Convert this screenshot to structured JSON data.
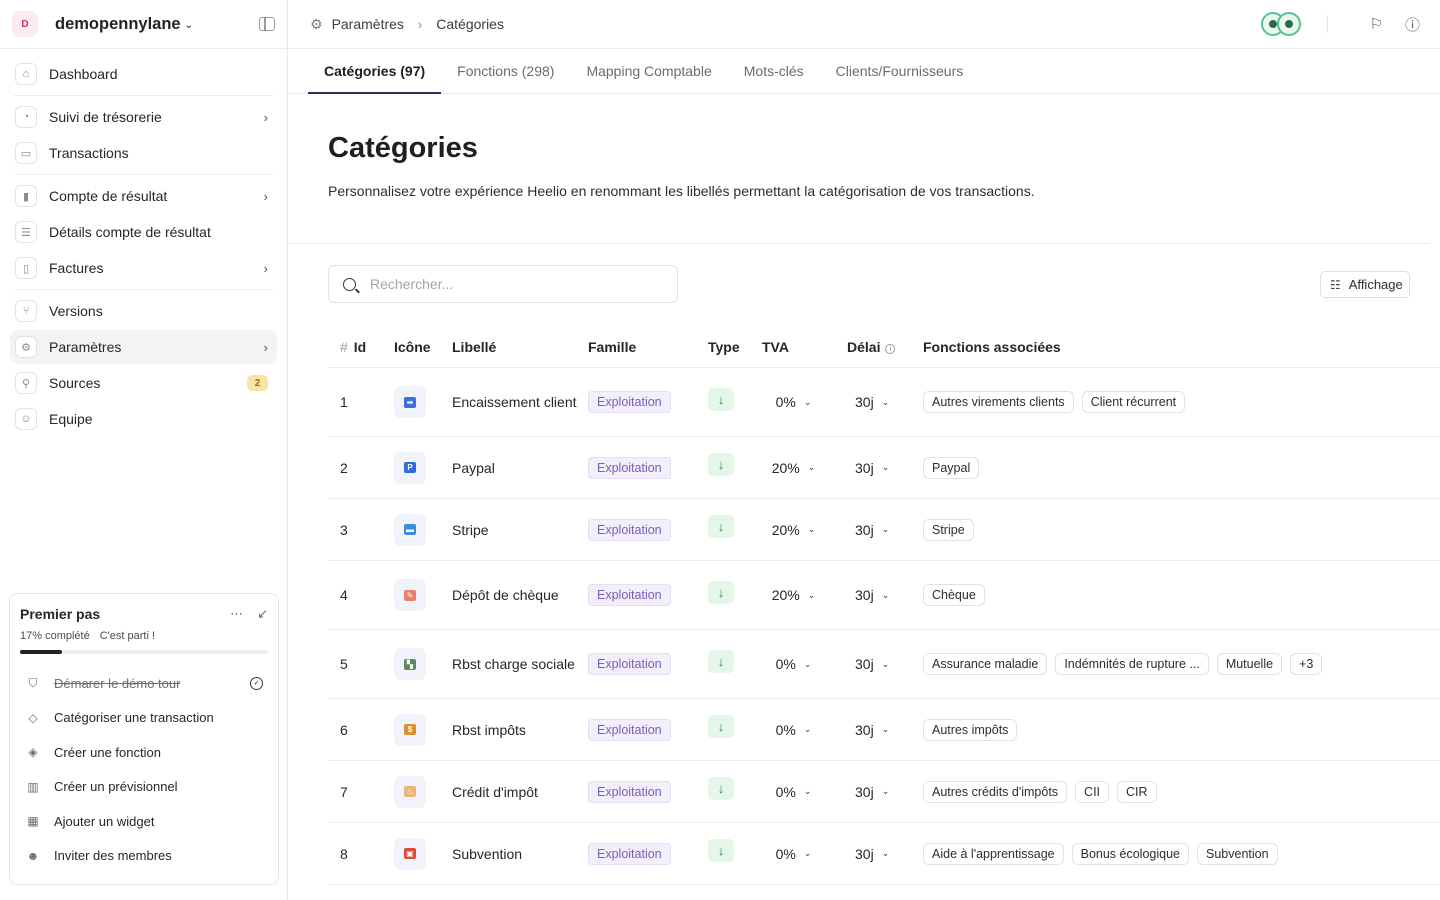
{
  "workspace": {
    "avatar": "D",
    "name": "demopennylane"
  },
  "nav": [
    {
      "label": "Dashboard",
      "icon": "home-icon",
      "glyph": "⌂",
      "chevron": false
    },
    {
      "sep": true
    },
    {
      "label": "Suivi de trésorerie",
      "icon": "chart-icon",
      "glyph": "◔",
      "chevron": true
    },
    {
      "label": "Transactions",
      "icon": "card-icon",
      "glyph": "▭",
      "chevron": false
    },
    {
      "sep": true
    },
    {
      "label": "Compte de résultat",
      "icon": "bar-chart-icon",
      "glyph": "▮",
      "chevron": true
    },
    {
      "label": "Détails compte de résultat",
      "icon": "list-icon",
      "glyph": "☰",
      "chevron": false
    },
    {
      "label": "Factures",
      "icon": "file-icon",
      "glyph": "▯",
      "chevron": true
    },
    {
      "sep": true
    },
    {
      "label": "Versions",
      "icon": "branch-icon",
      "glyph": "⑂",
      "chevron": false
    },
    {
      "label": "Paramètres",
      "icon": "gear-icon",
      "glyph": "⚙",
      "chevron": true,
      "active": true
    },
    {
      "label": "Sources",
      "icon": "plug-icon",
      "glyph": "⚲",
      "chevron": false,
      "badge": "2"
    },
    {
      "label": "Equipe",
      "icon": "user-icon",
      "glyph": "☺",
      "chevron": false
    }
  ],
  "onboarding": {
    "title": "Premier pas",
    "progress_text": "17% complété",
    "progress_value": 0.17,
    "status_text": "C'est parti !",
    "items": [
      {
        "label": "Démarer le démo tour",
        "icon": "shield-icon",
        "glyph": "⛉",
        "done": true
      },
      {
        "label": "Catégoriser une transaction",
        "icon": "tag-icon",
        "glyph": "◇"
      },
      {
        "label": "Créer une fonction",
        "icon": "tags-icon",
        "glyph": "◈"
      },
      {
        "label": "Créer un prévisionnel",
        "icon": "forecast-icon",
        "glyph": "▥"
      },
      {
        "label": "Ajouter un widget",
        "icon": "grid-icon",
        "glyph": "▦"
      },
      {
        "label": "Inviter des membres",
        "icon": "users-icon",
        "glyph": "☻"
      }
    ]
  },
  "breadcrumb": [
    "Paramètres",
    "Catégories"
  ],
  "tabs": [
    {
      "label": "Catégories (97)",
      "active": true
    },
    {
      "label": "Fonctions (298)"
    },
    {
      "label": "Mapping Comptable"
    },
    {
      "label": "Mots-clés"
    },
    {
      "label": "Clients/Fournisseurs"
    }
  ],
  "page": {
    "title": "Catégories",
    "description": "Personnalisez votre expérience Heelio en renommant les libellés permettant la catégorisation de vos transactions."
  },
  "search": {
    "placeholder": "Rechercher..."
  },
  "display_button": "Affichage",
  "table": {
    "headers": {
      "hash": "#",
      "id": "Id",
      "icon": "Icône",
      "label": "Libellé",
      "family": "Famille",
      "type": "Type",
      "tva": "TVA",
      "delay": "Délai",
      "functions": "Fonctions associées"
    },
    "rows": [
      {
        "id": "1",
        "label": "Encaissement client",
        "icon": "transfer-icon",
        "icon_color": "#3b6fd9",
        "icon_glyph": "➡",
        "family": "Exploitation",
        "tva": "0%",
        "delay": "30j",
        "functions": [
          "Autres virements clients",
          "Client récurrent"
        ]
      },
      {
        "id": "2",
        "label": "Paypal",
        "icon": "paypal-icon",
        "icon_color": "#2d6cdf",
        "icon_glyph": "P",
        "family": "Exploitation",
        "tva": "20%",
        "delay": "30j",
        "functions": [
          "Paypal"
        ]
      },
      {
        "id": "3",
        "label": "Stripe",
        "icon": "credit-card-icon",
        "icon_color": "#3b8fd9",
        "icon_glyph": "▬",
        "family": "Exploitation",
        "tva": "20%",
        "delay": "30j",
        "functions": [
          "Stripe"
        ]
      },
      {
        "id": "4",
        "label": "Dépôt de chèque",
        "icon": "check-icon",
        "icon_color": "#e8806b",
        "icon_glyph": "✎",
        "family": "Exploitation",
        "tva": "20%",
        "delay": "30j",
        "functions": [
          "Chèque"
        ]
      },
      {
        "id": "5",
        "label": "Rbst charge sociale",
        "icon": "social-charge-icon",
        "icon_color": "#5b8a5b",
        "icon_glyph": "▚",
        "family": "Exploitation",
        "tva": "0%",
        "delay": "30j",
        "functions": [
          "Assurance maladie",
          "Indémnités de rupture ...",
          "Mutuelle",
          "+3"
        ]
      },
      {
        "id": "6",
        "label": "Rbst impôts",
        "icon": "money-bag-icon",
        "icon_color": "#d9912b",
        "icon_glyph": "$",
        "family": "Exploitation",
        "tva": "0%",
        "delay": "30j",
        "functions": [
          "Autres impôts"
        ]
      },
      {
        "id": "7",
        "label": "Crédit d'impôt",
        "icon": "cake-icon",
        "icon_color": "#e9b878",
        "icon_glyph": "♨",
        "family": "Exploitation",
        "tva": "0%",
        "delay": "30j",
        "functions": [
          "Autres crédits d'impôts",
          "CII",
          "CIR"
        ]
      },
      {
        "id": "8",
        "label": "Subvention",
        "icon": "gift-icon",
        "icon_color": "#e0483a",
        "icon_glyph": "▣",
        "family": "Exploitation",
        "tva": "0%",
        "delay": "30j",
        "functions": [
          "Aide à l'apprentissage",
          "Bonus écologique",
          "Subvention"
        ]
      }
    ]
  }
}
